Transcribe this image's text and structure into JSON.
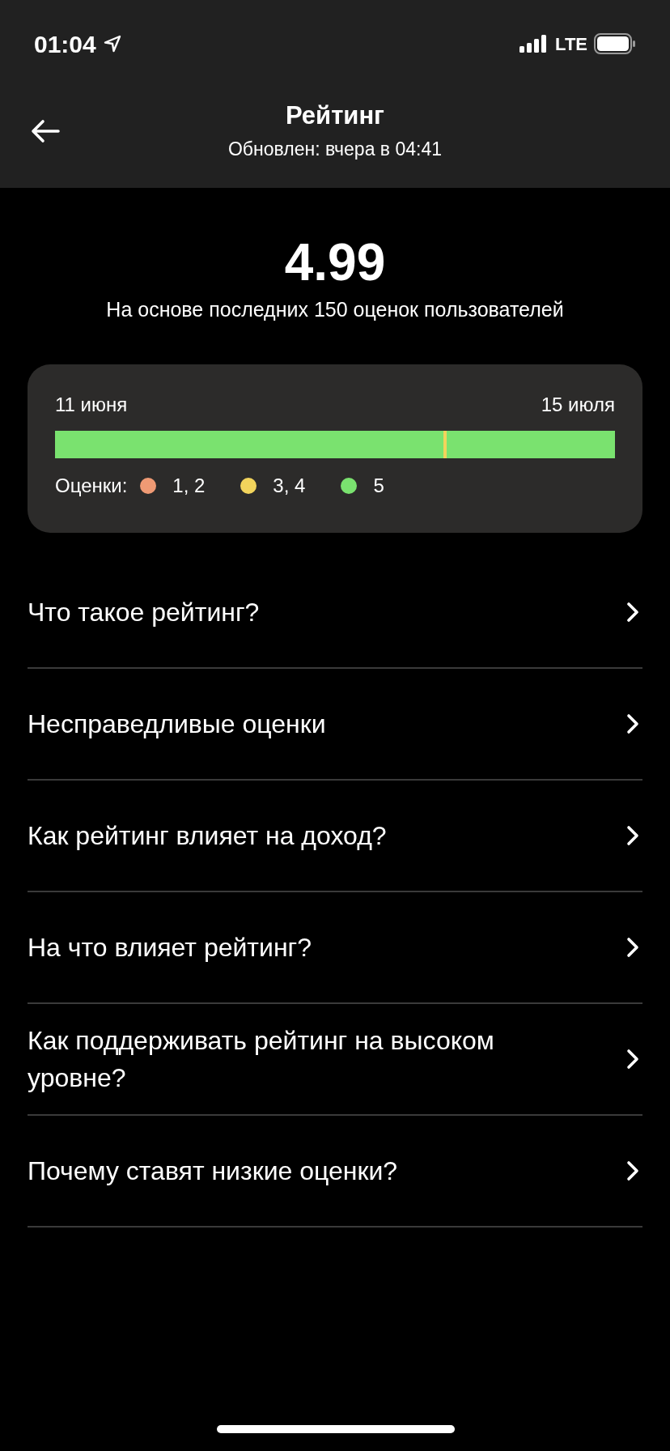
{
  "status_bar": {
    "time": "01:04",
    "network": "LTE"
  },
  "header": {
    "title": "Рейтинг",
    "subtitle": "Обновлен: вчера в 04:41"
  },
  "rating": {
    "value": "4.99",
    "caption": "На основе последних 150 оценок пользователей"
  },
  "history": {
    "start_label": "11 июня",
    "end_label": "15 июля",
    "bar": {
      "level": 0.7
    },
    "legend_label": "Оценки:",
    "legend": [
      {
        "label": "1, 2",
        "color": "#ef9a74"
      },
      {
        "label": "3, 4",
        "color": "#f2d45c"
      },
      {
        "label": "5",
        "color": "#7ae26f"
      }
    ]
  },
  "faq": [
    {
      "label": "Что такое рейтинг?"
    },
    {
      "label": "Несправедливые оценки"
    },
    {
      "label": "Как рейтинг влияет на доход?"
    },
    {
      "label": "На что влияет рейтинг?"
    },
    {
      "label": "Как поддерживать рейтинг на высоком уровне?"
    },
    {
      "label": "Почему ставят низкие оценки?"
    }
  ]
}
